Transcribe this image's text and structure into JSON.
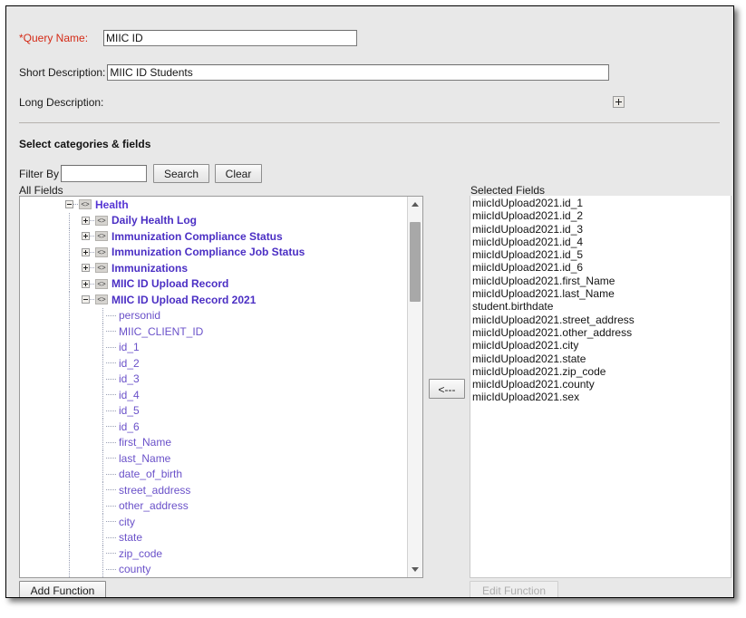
{
  "form": {
    "query_name_label": "*Query Name:",
    "query_name_value": "MIIC ID",
    "short_description_label": "Short Description:",
    "short_description_value": "MIIC ID Students",
    "long_description_label": "Long Description:",
    "long_description_expand_icon": "plus-icon"
  },
  "section": {
    "heading": "Select categories & fields"
  },
  "filter": {
    "label": "Filter By",
    "value": "",
    "search_label": "Search",
    "clear_label": "Clear"
  },
  "lists": {
    "all_fields_label": "All Fields",
    "selected_fields_label": "Selected Fields"
  },
  "tree": [
    {
      "label": "Health",
      "level": 0,
      "type": "root",
      "state": "expanded",
      "icon": "code-brackets-icon"
    },
    {
      "label": "Daily Health Log",
      "level": 1,
      "type": "category",
      "state": "collapsed",
      "icon": "code-brackets-icon"
    },
    {
      "label": "Immunization Compliance Status",
      "level": 1,
      "type": "category",
      "state": "collapsed",
      "icon": "code-brackets-icon"
    },
    {
      "label": "Immunization Compliance Job Status",
      "level": 1,
      "type": "category",
      "state": "collapsed",
      "icon": "code-brackets-icon"
    },
    {
      "label": "Immunizations",
      "level": 1,
      "type": "category",
      "state": "collapsed",
      "icon": "code-brackets-icon"
    },
    {
      "label": "MIIC ID Upload Record",
      "level": 1,
      "type": "category",
      "state": "collapsed",
      "icon": "code-brackets-icon"
    },
    {
      "label": "MIIC ID Upload Record 2021",
      "level": 1,
      "type": "category",
      "state": "expanded",
      "icon": "code-brackets-icon"
    },
    {
      "label": "personid",
      "level": 2,
      "type": "leaf"
    },
    {
      "label": "MIIC_CLIENT_ID",
      "level": 2,
      "type": "leaf"
    },
    {
      "label": "id_1",
      "level": 2,
      "type": "leaf"
    },
    {
      "label": "id_2",
      "level": 2,
      "type": "leaf"
    },
    {
      "label": "id_3",
      "level": 2,
      "type": "leaf"
    },
    {
      "label": "id_4",
      "level": 2,
      "type": "leaf"
    },
    {
      "label": "id_5",
      "level": 2,
      "type": "leaf"
    },
    {
      "label": "id_6",
      "level": 2,
      "type": "leaf"
    },
    {
      "label": "first_Name",
      "level": 2,
      "type": "leaf"
    },
    {
      "label": "last_Name",
      "level": 2,
      "type": "leaf"
    },
    {
      "label": "date_of_birth",
      "level": 2,
      "type": "leaf"
    },
    {
      "label": "street_address",
      "level": 2,
      "type": "leaf"
    },
    {
      "label": "other_address",
      "level": 2,
      "type": "leaf"
    },
    {
      "label": "city",
      "level": 2,
      "type": "leaf"
    },
    {
      "label": "state",
      "level": 2,
      "type": "leaf"
    },
    {
      "label": "zip_code",
      "level": 2,
      "type": "leaf"
    },
    {
      "label": "county",
      "level": 2,
      "type": "leaf"
    }
  ],
  "selected_fields": [
    "miicIdUpload2021.id_1",
    "miicIdUpload2021.id_2",
    "miicIdUpload2021.id_3",
    "miicIdUpload2021.id_4",
    "miicIdUpload2021.id_5",
    "miicIdUpload2021.id_6",
    "miicIdUpload2021.first_Name",
    "miicIdUpload2021.last_Name",
    "student.birthdate",
    "miicIdUpload2021.street_address",
    "miicIdUpload2021.other_address",
    "miicIdUpload2021.city",
    "miicIdUpload2021.state",
    "miicIdUpload2021.zip_code",
    "miicIdUpload2021.county",
    "miicIdUpload2021.sex"
  ],
  "buttons": {
    "move_left_label": "<---",
    "add_function_label": "Add Function",
    "edit_function_label": "Edit Function",
    "edit_function_enabled": false
  },
  "colors": {
    "required_label": "#d42a16",
    "tree_category": "#4b2fc4",
    "tree_leaf": "#6a51c9",
    "window_background": "#e8e8e8"
  }
}
